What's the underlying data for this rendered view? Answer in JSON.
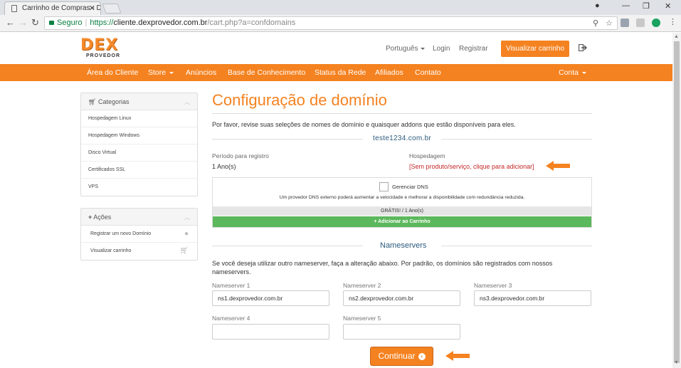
{
  "browser": {
    "tab_title": "Carrinho de Compras - D",
    "secure_label": "Seguro",
    "url_scheme": "https://",
    "url_host": "cliente.dexprovedor.com.br",
    "url_path": "/cart.php?a=confdomains"
  },
  "header": {
    "logo_main": "DEX",
    "logo_sub": "PROVEDOR",
    "language": "Português",
    "login": "Login",
    "register": "Registrar",
    "view_cart": "Visualizar carrinho"
  },
  "nav": {
    "items": [
      "Área do Cliente",
      "Store",
      "Anúncios",
      "Base de Conhecimento",
      "Status da Rede",
      "Afiliados",
      "Contato"
    ],
    "account": "Conta"
  },
  "sidebar": {
    "categories_title": "Categorias",
    "categories": [
      "Hospedagem Linux",
      "Hospedagem Windows",
      "Disco Virtual",
      "Certificados SSL",
      "VPS"
    ],
    "actions_title": "Ações",
    "actions": [
      "Registrar um novo Domínio",
      "Visualizar carrinho"
    ]
  },
  "main": {
    "title": "Configuração de domínio",
    "intro": "Por favor, revise suas seleções de nomes de domínio e quaisquer addons que estão disponíveis para eles.",
    "domain": "teste1234.com.br",
    "period_label": "Período para registro",
    "period_value": "1 Ano(s)",
    "hosting_label": "Hospedagem",
    "hosting_link": "[Sem produto/serviço, clique para adicionar]",
    "dns_title": "Gerenciar DNS",
    "dns_desc": "Um provedor DNS externo poderá aumentar a velocidade e melhorar a disponibilidade com redundância reduzida.",
    "dns_price": "GRÁTIS! / 1 Ano(s)",
    "add_to_cart": "Adicionar ao Carrinho",
    "ns_heading": "Nameservers",
    "ns_text_line1": "Se você deseja utilizar outro nameserver, faça a alteração abaixo. Por padrão, os domínios são registrados com nossos",
    "ns_text_line2": "nameservers.",
    "nameservers": [
      {
        "label": "Nameserver 1",
        "value": "ns1.dexprovedor.com.br"
      },
      {
        "label": "Nameserver 2",
        "value": "ns2.dexprovedor.com.br"
      },
      {
        "label": "Nameserver 3",
        "value": "ns3.dexprovedor.com.br"
      },
      {
        "label": "Nameserver 4",
        "value": ""
      },
      {
        "label": "Nameserver 5",
        "value": ""
      }
    ],
    "continue": "Continuar"
  },
  "colors": {
    "brand_orange": "#f58220",
    "add_green": "#5cb85c",
    "link_red": "#c62828"
  }
}
